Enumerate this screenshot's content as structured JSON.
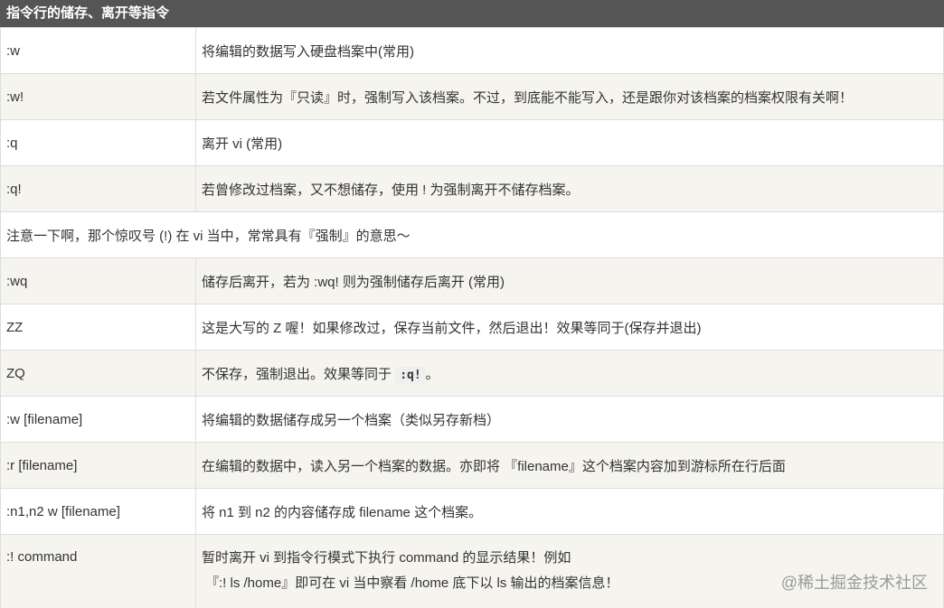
{
  "header": {
    "title": "指令行的储存、离开等指令"
  },
  "rows": [
    {
      "cmd": ":w",
      "desc": "将编辑的数据写入硬盘档案中(常用)"
    },
    {
      "cmd": ":w!",
      "desc": "若文件属性为『只读』时，强制写入该档案。不过，到底能不能写入，还是跟你对该档案的档案权限有关啊！"
    },
    {
      "cmd": ":q",
      "desc": "离开 vi (常用)"
    },
    {
      "cmd": ":q!",
      "desc": "若曾修改过档案，又不想储存，使用 ! 为强制离开不储存档案。"
    },
    {
      "note": "注意一下啊，那个惊叹号 (!) 在 vi 当中，常常具有『强制』的意思～"
    },
    {
      "cmd": ":wq",
      "desc": "储存后离开，若为 :wq! 则为强制储存后离开 (常用)"
    },
    {
      "cmd": "ZZ",
      "desc": "这是大写的 Z 喔！如果修改过，保存当前文件，然后退出！效果等同于(保存并退出)"
    },
    {
      "cmd": "ZQ",
      "desc_pre": "不保存，强制退出。效果等同于",
      "desc_code": ":q!",
      "desc_post": "。"
    },
    {
      "cmd": ":w [filename]",
      "desc": "将编辑的数据储存成另一个档案（类似另存新档）"
    },
    {
      "cmd": ":r [filename]",
      "desc": "在编辑的数据中，读入另一个档案的数据。亦即将 『filename』这个档案内容加到游标所在行后面"
    },
    {
      "cmd": ":n1,n2 w [filename]",
      "desc": "将 n1 到 n2 的内容储存成 filename 这个档案。"
    },
    {
      "cmd": ":! command",
      "desc": "暂时离开 vi 到指令行模式下执行 command 的显示结果！例如",
      "desc2": "『:! ls /home』即可在 vi 当中察看 /home 底下以 ls 输出的档案信息！"
    }
  ],
  "watermark": "@稀土掘金技术社区"
}
